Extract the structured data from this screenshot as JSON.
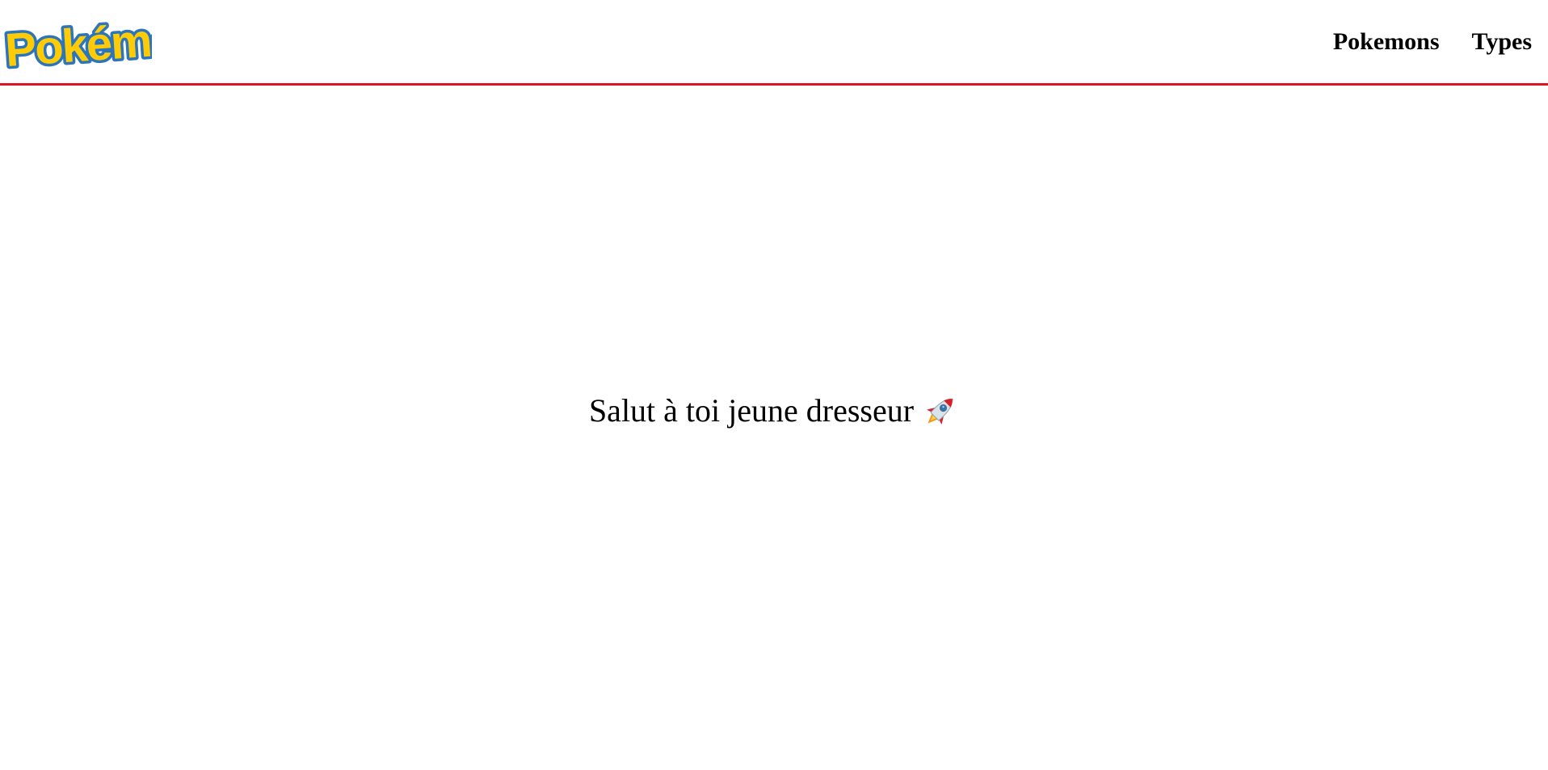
{
  "header": {
    "logo_text": "Pokémon",
    "logo_icon": "pokemon-logo",
    "border_color": "#e0141e",
    "nav": [
      {
        "label": "Pokemons"
      },
      {
        "label": "Types"
      }
    ]
  },
  "main": {
    "welcome_text": "Salut à toi jeune dresseur",
    "welcome_icon": "rocket-icon"
  },
  "colors": {
    "logo_yellow": "#ffcb05",
    "logo_blue": "#2a75bb",
    "accent_red": "#e0141e"
  }
}
